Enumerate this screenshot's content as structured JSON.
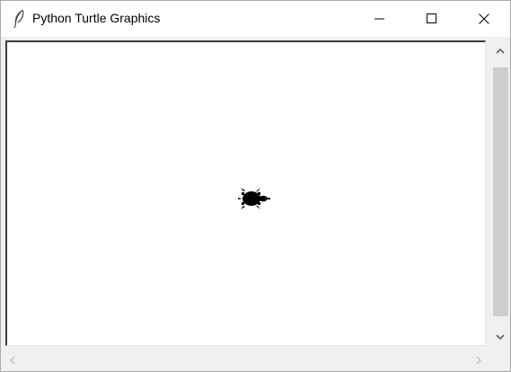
{
  "window": {
    "title": "Python Turtle Graphics",
    "icon": "feather-icon"
  },
  "titlebar_buttons": {
    "minimize_icon": "minimize-icon",
    "maximize_icon": "maximize-icon",
    "close_icon": "close-icon"
  },
  "canvas": {
    "background": "#ffffff",
    "turtle_shape": "turtle",
    "turtle_color": "#000000",
    "turtle_heading": "east"
  },
  "scrollbars": {
    "vertical": {
      "up_icon": "chevron-up-icon",
      "down_icon": "chevron-down-icon"
    },
    "horizontal": {
      "left_icon": "chevron-left-icon",
      "right_icon": "chevron-right-icon"
    }
  }
}
